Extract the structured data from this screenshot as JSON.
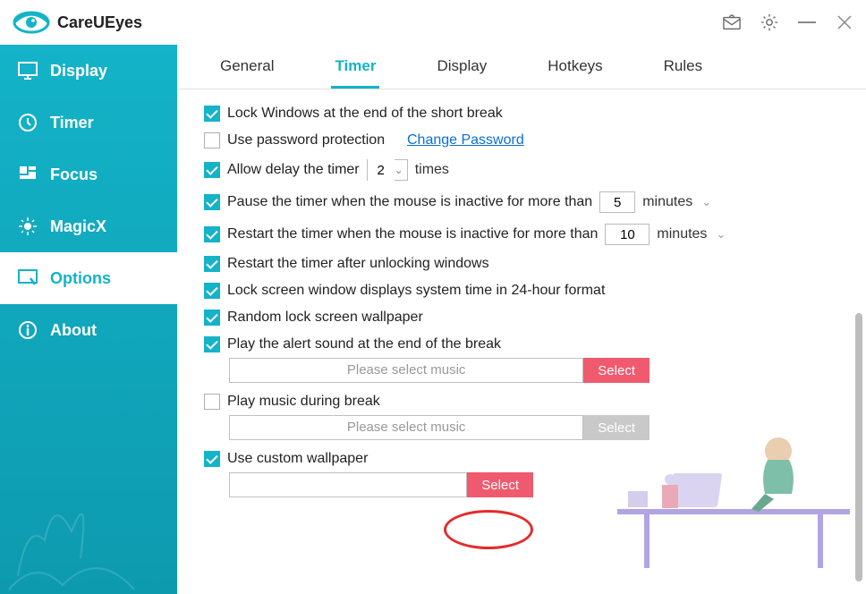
{
  "app": {
    "name": "CareUEyes"
  },
  "sidebar": {
    "items": [
      {
        "label": "Display"
      },
      {
        "label": "Timer"
      },
      {
        "label": "Focus"
      },
      {
        "label": "MagicX"
      },
      {
        "label": "Options"
      },
      {
        "label": "About"
      }
    ],
    "active": 4
  },
  "tabs": {
    "items": [
      {
        "label": "General"
      },
      {
        "label": "Timer"
      },
      {
        "label": "Display"
      },
      {
        "label": "Hotkeys"
      },
      {
        "label": "Rules"
      }
    ],
    "active": 1
  },
  "settings": {
    "lockWindows": {
      "checked": true,
      "label": "Lock Windows at the end of the short break"
    },
    "passwordProtect": {
      "checked": false,
      "label": "Use password protection",
      "link": "Change Password"
    },
    "allowDelay": {
      "checked": true,
      "prefix": "Allow delay the timer",
      "value": "2",
      "suffix": "times"
    },
    "pauseInactive": {
      "checked": true,
      "prefix": "Pause the timer when the mouse is inactive for more than",
      "value": "5",
      "suffix": "minutes"
    },
    "restartInactive": {
      "checked": true,
      "prefix": "Restart the timer when the mouse is inactive for more than",
      "value": "10",
      "suffix": "minutes"
    },
    "restartUnlock": {
      "checked": true,
      "label": "Restart the timer after unlocking windows"
    },
    "show24h": {
      "checked": true,
      "label": "Lock screen window displays system time in 24-hour format"
    },
    "randomWallpaper": {
      "checked": true,
      "label": "Random lock screen wallpaper"
    },
    "alertSound": {
      "checked": true,
      "label": "Play the alert sound at the end of the break",
      "placeholder": "Please select music",
      "button": "Select"
    },
    "playMusic": {
      "checked": false,
      "label": "Play music during break",
      "placeholder": "Please select music",
      "button": "Select"
    },
    "customWallpaper": {
      "checked": true,
      "label": "Use custom wallpaper",
      "button": "Select"
    }
  }
}
